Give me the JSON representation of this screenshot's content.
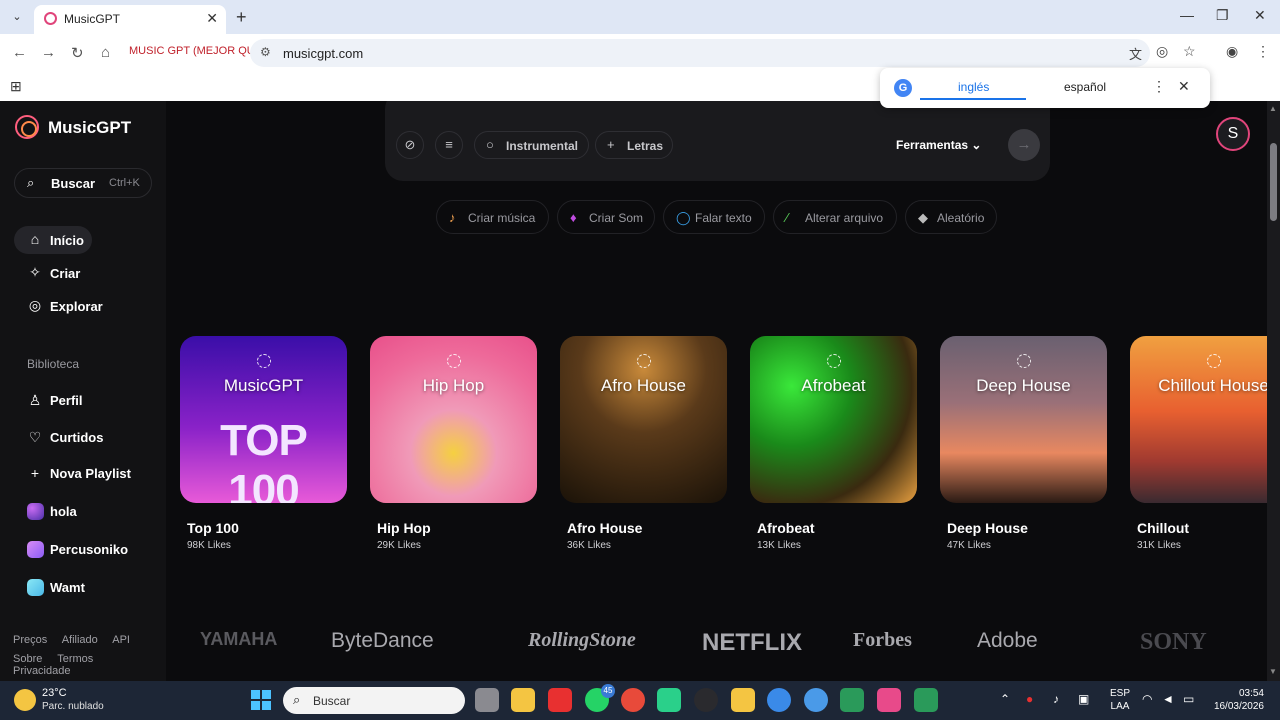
{
  "browser": {
    "tab_title": "MusicGPT",
    "url": "musicgpt.com",
    "bookmark_chip": "MUSIC GPT (MEJOR QUE",
    "translate": {
      "from": "inglés",
      "to": "español"
    }
  },
  "app": {
    "logo": "MusicGPT",
    "search": {
      "label": "Buscar",
      "shortcut": "Ctrl+K"
    },
    "nav": [
      {
        "label": "Início",
        "icon": "home-icon"
      },
      {
        "label": "Criar",
        "icon": "sparkle-icon"
      },
      {
        "label": "Explorar",
        "icon": "compass-icon"
      }
    ],
    "library_label": "Biblioteca",
    "library": [
      {
        "label": "Perfil",
        "icon": "user-icon"
      },
      {
        "label": "Curtidos",
        "icon": "heart-icon"
      },
      {
        "label": "Nova Playlist",
        "icon": "plus-icon"
      },
      {
        "label": "hola",
        "color": "#8a5cf5"
      },
      {
        "label": "Percusoniko",
        "color": "#b77cf0"
      },
      {
        "label": "Wamt",
        "color": "#6ad0e8"
      }
    ],
    "footer": [
      "Preços",
      "Afiliado",
      "API",
      "Sobre",
      "Termos",
      "Privacidade"
    ],
    "avatar_letter": "S"
  },
  "prompt": {
    "instrumental": "Instrumental",
    "letras": "Letras",
    "tools": "Ferramentas"
  },
  "chips": [
    {
      "label": "Criar música",
      "icon": "music-note-icon",
      "color": "#f0a050"
    },
    {
      "label": "Criar Som",
      "icon": "soundwave-icon",
      "color": "#c04ce0"
    },
    {
      "label": "Falar texto",
      "icon": "speech-bubble-icon",
      "color": "#3aa0e8"
    },
    {
      "label": "Alterar arquivo",
      "icon": "wand-icon",
      "color": "#5ad05a"
    },
    {
      "label": "Aleatório",
      "icon": "dice-icon",
      "color": "#bbbbbb"
    }
  ],
  "cards": [
    {
      "art_title": "MusicGPT",
      "art_sub": "TOP 100",
      "name": "Top 100",
      "likes": "98K Likes"
    },
    {
      "art_title": "Hip Hop",
      "name": "Hip Hop",
      "likes": "29K Likes"
    },
    {
      "art_title": "Afro House",
      "name": "Afro House",
      "likes": "36K Likes"
    },
    {
      "art_title": "Afrobeat",
      "name": "Afrobeat",
      "likes": "13K Likes"
    },
    {
      "art_title": "Deep House",
      "name": "Deep House",
      "likes": "47K Likes"
    },
    {
      "art_title": "Chillout House",
      "name": "Chillout",
      "likes": "31K Likes"
    }
  ],
  "brands": [
    "YAMAHA",
    "ByteDance",
    "RollingStone",
    "NETFLIX",
    "Forbes",
    "Adobe",
    "SONY"
  ],
  "taskbar": {
    "temp": "23°C",
    "weather": "Parc. nublado",
    "search": "Buscar",
    "lang1": "ESP",
    "lang2": "LAA",
    "time": "03:54",
    "date": "16/03/2026",
    "badge_whatsapp": "45"
  }
}
